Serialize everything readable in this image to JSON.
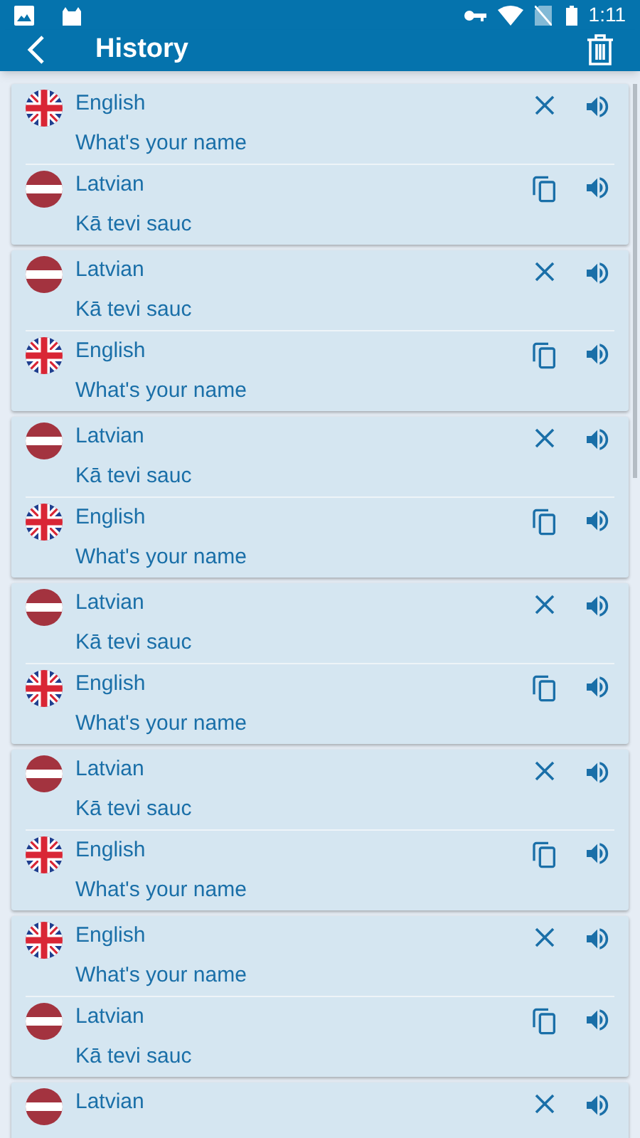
{
  "status_bar": {
    "time": "1:11"
  },
  "app_bar": {
    "title": "History"
  },
  "cards": [
    {
      "source": {
        "kind": "uk",
        "language": "English",
        "text": "What's your name"
      },
      "target": {
        "kind": "lv",
        "language": "Latvian",
        "text": "Kā tevi sauc"
      }
    },
    {
      "source": {
        "kind": "lv",
        "language": "Latvian",
        "text": "Kā tevi sauc"
      },
      "target": {
        "kind": "uk",
        "language": "English",
        "text": "What's your name"
      }
    },
    {
      "source": {
        "kind": "lv",
        "language": "Latvian",
        "text": "Kā tevi sauc"
      },
      "target": {
        "kind": "uk",
        "language": "English",
        "text": "What's your name"
      }
    },
    {
      "source": {
        "kind": "lv",
        "language": "Latvian",
        "text": "Kā tevi sauc"
      },
      "target": {
        "kind": "uk",
        "language": "English",
        "text": "What's your name"
      }
    },
    {
      "source": {
        "kind": "lv",
        "language": "Latvian",
        "text": "Kā tevi sauc"
      },
      "target": {
        "kind": "uk",
        "language": "English",
        "text": "What's your name"
      }
    },
    {
      "source": {
        "kind": "uk",
        "language": "English",
        "text": "What's your name"
      },
      "target": {
        "kind": "lv",
        "language": "Latvian",
        "text": "Kā tevi sauc"
      }
    },
    {
      "source": {
        "kind": "lv",
        "language": "Latvian"
      }
    }
  ]
}
